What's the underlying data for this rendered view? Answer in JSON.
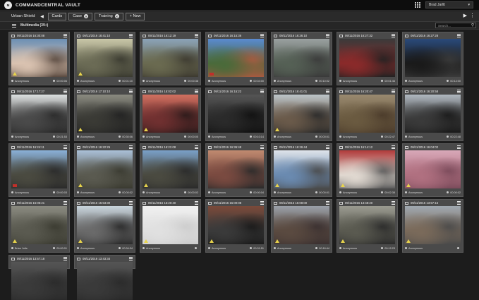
{
  "app": {
    "logo_text": "M",
    "title": "COMMANDCENTRAL VAULT",
    "user": "Brad Jarltt"
  },
  "tabs": {
    "breadcrumb": "Urban Shield",
    "items": [
      {
        "label": "Cards",
        "closable": false
      },
      {
        "label": "Case",
        "closable": true
      },
      {
        "label": "Training",
        "closable": true
      },
      {
        "label": "+ New",
        "closable": false
      }
    ]
  },
  "toolbar": {
    "section": "Multimedia (39+)",
    "search_placeholder": "Search..."
  },
  "cards": [
    {
      "date": "09/11/2016 16:30:08",
      "author": "Anonymous",
      "duration": "00:00:06",
      "flag": false,
      "warn": true,
      "colors": [
        "#6b8fb5",
        "#d9c2b0",
        "#5a4a40"
      ]
    },
    {
      "date": "09/11/2016 18:41:10",
      "author": "Anonymous",
      "duration": "00:01:10",
      "flag": false,
      "warn": true,
      "colors": [
        "#c9c7a8",
        "#6b6b55",
        "#3a3a30"
      ]
    },
    {
      "date": "09/11/2016 16:12:19",
      "author": "Anonymous",
      "duration": "00:00:38",
      "flag": false,
      "warn": false,
      "colors": [
        "#8ba3b8",
        "#6a6a50",
        "#3d3a30"
      ]
    },
    {
      "date": "09/11/2016 16:15:36",
      "author": "Anonymous",
      "duration": "00:04:00",
      "flag": true,
      "warn": false,
      "colors": [
        "#5a8ad0",
        "#4a6a3a",
        "#a85a40"
      ]
    },
    {
      "date": "09/11/2016 16:26:10",
      "author": "Anonymous",
      "duration": "00:10:02",
      "flag": false,
      "warn": false,
      "colors": [
        "#9aa0a0",
        "#556055",
        "#3a3a3a"
      ]
    },
    {
      "date": "09/11/2016 16:27:32",
      "author": "Anonymous",
      "duration": "00:01:46",
      "flag": false,
      "warn": false,
      "colors": [
        "#3a3a3a",
        "#8a2a2a",
        "#222222"
      ]
    },
    {
      "date": "09/11/2016 16:27:28",
      "author": "Anonymous",
      "duration": "00:14:00",
      "flag": false,
      "warn": false,
      "colors": [
        "#2a4a7a",
        "#1a1a1a",
        "#3a3a3a"
      ]
    },
    {
      "date": "09/11/2016 17:17:27",
      "author": "Anonymous",
      "duration": "00:21:53",
      "flag": false,
      "warn": false,
      "colors": [
        "#dde0e0",
        "#4a4a4a",
        "#2a2a2a"
      ]
    },
    {
      "date": "09/11/2016 17:10:10",
      "author": "Anonymous",
      "duration": "00:30:06",
      "flag": false,
      "warn": true,
      "colors": [
        "#8a8a80",
        "#3a3a35",
        "#222222"
      ]
    },
    {
      "date": "09/11/2016 15:02:02",
      "author": "Anonymous",
      "duration": "00:00:05",
      "flag": false,
      "warn": true,
      "colors": [
        "#d07060",
        "#703030",
        "#2a1a1a"
      ]
    },
    {
      "date": "09/11/2016 16:15:22",
      "author": "Anonymous",
      "duration": "00:10:14",
      "flag": false,
      "warn": false,
      "colors": [
        "#555555",
        "#2a2a2a",
        "#111111"
      ]
    },
    {
      "date": "09/11/2016 16:41:01",
      "author": "Anonymous",
      "duration": "00:00:01",
      "flag": false,
      "warn": true,
      "colors": [
        "#bcc4c8",
        "#6a5a4a",
        "#2a2a2a"
      ]
    },
    {
      "date": "09/11/2016 16:20:47",
      "author": "Anonymous",
      "duration": "00:22:47",
      "flag": false,
      "warn": false,
      "colors": [
        "#9a8a70",
        "#6a5a40",
        "#4a3a2a"
      ]
    },
    {
      "date": "09/11/2016 16:20:58",
      "author": "Anonymous",
      "duration": "00:22:48",
      "flag": false,
      "warn": false,
      "colors": [
        "#b0b8c0",
        "#3a3a3a",
        "#1a1a1a"
      ]
    },
    {
      "date": "09/11/2016 16:24:11",
      "author": "Anonymous",
      "duration": "00:00:03",
      "flag": true,
      "warn": false,
      "colors": [
        "#8ab0d8",
        "#4a4a40",
        "#2a2a2a"
      ]
    },
    {
      "date": "09/11/2016 16:22:25",
      "author": "Anonymous",
      "duration": "00:00:02",
      "flag": false,
      "warn": true,
      "colors": [
        "#aac0d8",
        "#5a5a50",
        "#3a3a30"
      ]
    },
    {
      "date": "09/11/2016 16:21:08",
      "author": "Anonymous",
      "duration": "00:00:02",
      "flag": false,
      "warn": true,
      "colors": [
        "#7aa0c8",
        "#4a4a40",
        "#2a2a2a"
      ]
    },
    {
      "date": "09/11/2016 16:36:48",
      "author": "Anonymous",
      "duration": "00:00:04",
      "flag": false,
      "warn": false,
      "colors": [
        "#c08a70",
        "#7a4a40",
        "#2a2a2a"
      ]
    },
    {
      "date": "09/11/2016 16:26:44",
      "author": "Anonymous",
      "duration": "00:00:01",
      "flag": false,
      "warn": true,
      "colors": [
        "#dfe4ea",
        "#6a8ab0",
        "#4a4a4a"
      ]
    },
    {
      "date": "09/11/2016 16:14:12",
      "author": "Anonymous",
      "duration": "00:02:38",
      "flag": false,
      "warn": true,
      "colors": [
        "#b03a3a",
        "#e0d8d0",
        "#5a5a5a"
      ]
    },
    {
      "date": "09/11/2016 16:04:02",
      "author": "Anonymous",
      "duration": "00:00:02",
      "flag": false,
      "warn": true,
      "colors": [
        "#d8a8b8",
        "#b07080",
        "#7a4a5a"
      ]
    },
    {
      "date": "09/11/2016 16:06:21",
      "author": "Brian Jolts",
      "duration": "00:00:01",
      "flag": false,
      "warn": true,
      "colors": [
        "#8a8a80",
        "#5a5a50",
        "#3a3a30"
      ]
    },
    {
      "date": "09/11/2016 15:53:30",
      "author": "Anonymous",
      "duration": "00:34:34",
      "flag": false,
      "warn": true,
      "colors": [
        "#c8d4dc",
        "#6a6a6a",
        "#2a2a2a"
      ]
    },
    {
      "date": "09/11/2016 15:20:40",
      "author": "Anonymous",
      "duration": "",
      "flag": false,
      "warn": true,
      "colors": [
        "#f0f0f0",
        "#e0e0e0",
        "#cccccc"
      ]
    },
    {
      "date": "09/11/2016 15:00:08",
      "author": "Anonymous",
      "duration": "00:31:51",
      "flag": false,
      "warn": true,
      "colors": [
        "#7a4a3a",
        "#3a3a3a",
        "#1a1a1a"
      ]
    },
    {
      "date": "09/11/2016 15:08:00",
      "author": "Anonymous",
      "duration": "00:16:44",
      "flag": false,
      "warn": true,
      "colors": [
        "#9aa0a8",
        "#5a4a40",
        "#3a3030"
      ]
    },
    {
      "date": "09/11/2016 13:48:20",
      "author": "Anonymous",
      "duration": "00:12:23",
      "flag": false,
      "warn": true,
      "colors": [
        "#9a9a90",
        "#5a5a50",
        "#2a2a2a"
      ]
    },
    {
      "date": "09/11/2016 13:57:15",
      "author": "Anonymous",
      "duration": "",
      "flag": false,
      "warn": true,
      "colors": [
        "#a0a8b0",
        "#7a6a5a",
        "#4a4a4a"
      ]
    },
    {
      "date": "09/11/2016 13:57:18",
      "author": "",
      "duration": "",
      "flag": false,
      "warn": false,
      "colors": [
        "#555555",
        "#3a3a3a",
        "#2a2a2a"
      ]
    },
    {
      "date": "09/11/2016 13:43:34",
      "author": "",
      "duration": "",
      "flag": false,
      "warn": false,
      "colors": [
        "#555555",
        "#3a3a3a",
        "#2a2a2a"
      ]
    }
  ]
}
